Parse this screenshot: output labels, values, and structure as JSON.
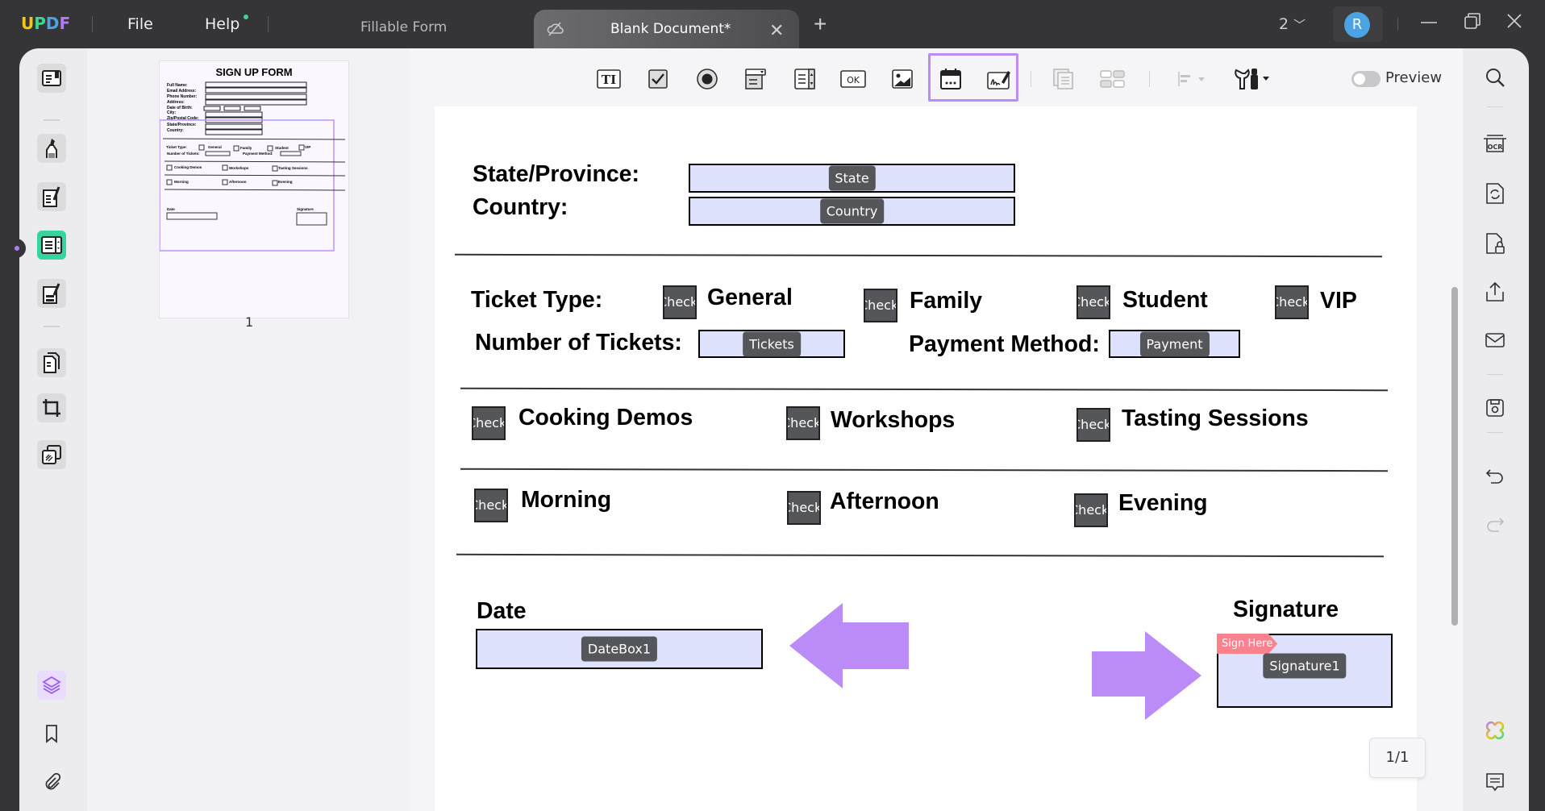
{
  "app": {
    "logo": [
      "U",
      "P",
      "D",
      "F"
    ],
    "logo_colors": [
      "#f5c518",
      "#3dd68c",
      "#4ba3e3",
      "#b07cf5"
    ],
    "menu": {
      "file": "File",
      "help": "Help"
    },
    "tabs": [
      {
        "label": "Fillable Form",
        "active": false
      },
      {
        "label": "Blank Document*",
        "active": true
      }
    ],
    "window_count": "2",
    "avatar_initial": "R"
  },
  "toolbar": {
    "tools": [
      "text-field",
      "checkbox",
      "radio-button",
      "dropdown",
      "list-box",
      "button",
      "image-field",
      "date-field",
      "signature-field"
    ],
    "highlighted": [
      "date-field",
      "signature-field"
    ],
    "preview_label": "Preview",
    "preview_on": false,
    "highlight_color": "#b98cf6"
  },
  "thumbnail": {
    "page_label": "1",
    "title": "SIGN UP FORM",
    "fields": [
      "Full Name:",
      "Email Address:",
      "Phone Number:",
      "Address:",
      "Date of Birth:",
      "City:",
      "Zip/Postal Code:",
      "State/Province:",
      "Country:"
    ],
    "ticket_row": [
      "Ticket Type:",
      "General",
      "Family",
      "Student",
      "VIP"
    ],
    "tickets_row": [
      "Number of Tickets:",
      "Payment Method:"
    ],
    "row_a": [
      "Cooking Demos",
      "Workshops",
      "Tasting Sessions"
    ],
    "row_b": [
      "Morning",
      "Afternoon",
      "Evening"
    ],
    "date": "Date",
    "signature": "Signature"
  },
  "form": {
    "state_label": "State/Province:",
    "state_field": "State",
    "country_label": "Country:",
    "country_field": "Country",
    "ticket_type_label": "Ticket Type:",
    "ticket_options": [
      "General",
      "Family",
      "Student",
      "VIP"
    ],
    "checkbox_tag": "Check Box",
    "num_tickets_label": "Number of Tickets:",
    "tickets_field": "Tickets",
    "payment_label": "Payment Method:",
    "payment_field": "Payment",
    "activities": [
      "Cooking Demos",
      "Workshops",
      "Tasting Sessions"
    ],
    "times": [
      "Morning",
      "Afternoon",
      "Evening"
    ],
    "date_label": "Date",
    "date_field": "DateBox1",
    "signature_label": "Signature",
    "signature_field": "Signature1",
    "sign_here": "Sign Here",
    "arrow_color": "#bb8cf8"
  },
  "pagination": {
    "current": "1/1"
  }
}
